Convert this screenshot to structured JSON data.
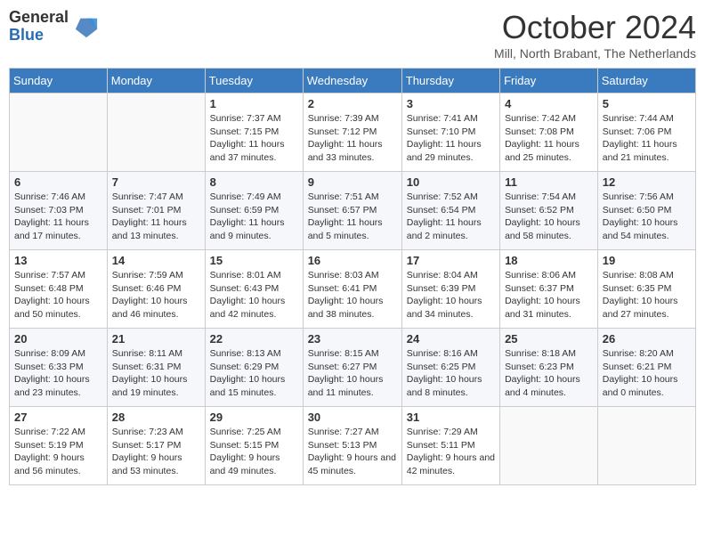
{
  "logo": {
    "general": "General",
    "blue": "Blue"
  },
  "header": {
    "month": "October 2024",
    "location": "Mill, North Brabant, The Netherlands"
  },
  "weekdays": [
    "Sunday",
    "Monday",
    "Tuesday",
    "Wednesday",
    "Thursday",
    "Friday",
    "Saturday"
  ],
  "weeks": [
    [
      {
        "day": "",
        "detail": ""
      },
      {
        "day": "",
        "detail": ""
      },
      {
        "day": "1",
        "detail": "Sunrise: 7:37 AM\nSunset: 7:15 PM\nDaylight: 11 hours and 37 minutes."
      },
      {
        "day": "2",
        "detail": "Sunrise: 7:39 AM\nSunset: 7:12 PM\nDaylight: 11 hours and 33 minutes."
      },
      {
        "day": "3",
        "detail": "Sunrise: 7:41 AM\nSunset: 7:10 PM\nDaylight: 11 hours and 29 minutes."
      },
      {
        "day": "4",
        "detail": "Sunrise: 7:42 AM\nSunset: 7:08 PM\nDaylight: 11 hours and 25 minutes."
      },
      {
        "day": "5",
        "detail": "Sunrise: 7:44 AM\nSunset: 7:06 PM\nDaylight: 11 hours and 21 minutes."
      }
    ],
    [
      {
        "day": "6",
        "detail": "Sunrise: 7:46 AM\nSunset: 7:03 PM\nDaylight: 11 hours and 17 minutes."
      },
      {
        "day": "7",
        "detail": "Sunrise: 7:47 AM\nSunset: 7:01 PM\nDaylight: 11 hours and 13 minutes."
      },
      {
        "day": "8",
        "detail": "Sunrise: 7:49 AM\nSunset: 6:59 PM\nDaylight: 11 hours and 9 minutes."
      },
      {
        "day": "9",
        "detail": "Sunrise: 7:51 AM\nSunset: 6:57 PM\nDaylight: 11 hours and 5 minutes."
      },
      {
        "day": "10",
        "detail": "Sunrise: 7:52 AM\nSunset: 6:54 PM\nDaylight: 11 hours and 2 minutes."
      },
      {
        "day": "11",
        "detail": "Sunrise: 7:54 AM\nSunset: 6:52 PM\nDaylight: 10 hours and 58 minutes."
      },
      {
        "day": "12",
        "detail": "Sunrise: 7:56 AM\nSunset: 6:50 PM\nDaylight: 10 hours and 54 minutes."
      }
    ],
    [
      {
        "day": "13",
        "detail": "Sunrise: 7:57 AM\nSunset: 6:48 PM\nDaylight: 10 hours and 50 minutes."
      },
      {
        "day": "14",
        "detail": "Sunrise: 7:59 AM\nSunset: 6:46 PM\nDaylight: 10 hours and 46 minutes."
      },
      {
        "day": "15",
        "detail": "Sunrise: 8:01 AM\nSunset: 6:43 PM\nDaylight: 10 hours and 42 minutes."
      },
      {
        "day": "16",
        "detail": "Sunrise: 8:03 AM\nSunset: 6:41 PM\nDaylight: 10 hours and 38 minutes."
      },
      {
        "day": "17",
        "detail": "Sunrise: 8:04 AM\nSunset: 6:39 PM\nDaylight: 10 hours and 34 minutes."
      },
      {
        "day": "18",
        "detail": "Sunrise: 8:06 AM\nSunset: 6:37 PM\nDaylight: 10 hours and 31 minutes."
      },
      {
        "day": "19",
        "detail": "Sunrise: 8:08 AM\nSunset: 6:35 PM\nDaylight: 10 hours and 27 minutes."
      }
    ],
    [
      {
        "day": "20",
        "detail": "Sunrise: 8:09 AM\nSunset: 6:33 PM\nDaylight: 10 hours and 23 minutes."
      },
      {
        "day": "21",
        "detail": "Sunrise: 8:11 AM\nSunset: 6:31 PM\nDaylight: 10 hours and 19 minutes."
      },
      {
        "day": "22",
        "detail": "Sunrise: 8:13 AM\nSunset: 6:29 PM\nDaylight: 10 hours and 15 minutes."
      },
      {
        "day": "23",
        "detail": "Sunrise: 8:15 AM\nSunset: 6:27 PM\nDaylight: 10 hours and 11 minutes."
      },
      {
        "day": "24",
        "detail": "Sunrise: 8:16 AM\nSunset: 6:25 PM\nDaylight: 10 hours and 8 minutes."
      },
      {
        "day": "25",
        "detail": "Sunrise: 8:18 AM\nSunset: 6:23 PM\nDaylight: 10 hours and 4 minutes."
      },
      {
        "day": "26",
        "detail": "Sunrise: 8:20 AM\nSunset: 6:21 PM\nDaylight: 10 hours and 0 minutes."
      }
    ],
    [
      {
        "day": "27",
        "detail": "Sunrise: 7:22 AM\nSunset: 5:19 PM\nDaylight: 9 hours and 56 minutes."
      },
      {
        "day": "28",
        "detail": "Sunrise: 7:23 AM\nSunset: 5:17 PM\nDaylight: 9 hours and 53 minutes."
      },
      {
        "day": "29",
        "detail": "Sunrise: 7:25 AM\nSunset: 5:15 PM\nDaylight: 9 hours and 49 minutes."
      },
      {
        "day": "30",
        "detail": "Sunrise: 7:27 AM\nSunset: 5:13 PM\nDaylight: 9 hours and 45 minutes."
      },
      {
        "day": "31",
        "detail": "Sunrise: 7:29 AM\nSunset: 5:11 PM\nDaylight: 9 hours and 42 minutes."
      },
      {
        "day": "",
        "detail": ""
      },
      {
        "day": "",
        "detail": ""
      }
    ]
  ]
}
